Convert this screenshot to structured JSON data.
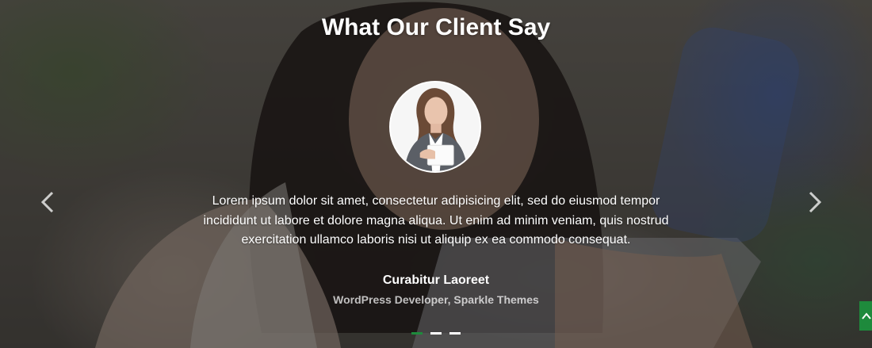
{
  "section": {
    "title": "What Our Client Say"
  },
  "testimonial": {
    "quote": "Lorem ipsum dolor sit amet, consectetur adipisicing elit, sed do eiusmod tempor incididunt ut labore et dolore magna aliqua. Ut enim ad minim veniam, quis nostrud exercitation ullamco laboris nisi ut aliquip ex ea commodo consequat.",
    "name": "Curabitur Laoreet",
    "role": "WordPress Developer, Sparkle Themes"
  },
  "navigation": {
    "prev_icon": "chevron-left-icon",
    "next_icon": "chevron-right-icon"
  },
  "pager": {
    "count": 3,
    "active_index": 0
  },
  "scroll_top": {
    "icon": "chevron-up-icon"
  },
  "colors": {
    "accent": "#1e8a3c",
    "text": "#ffffff"
  }
}
